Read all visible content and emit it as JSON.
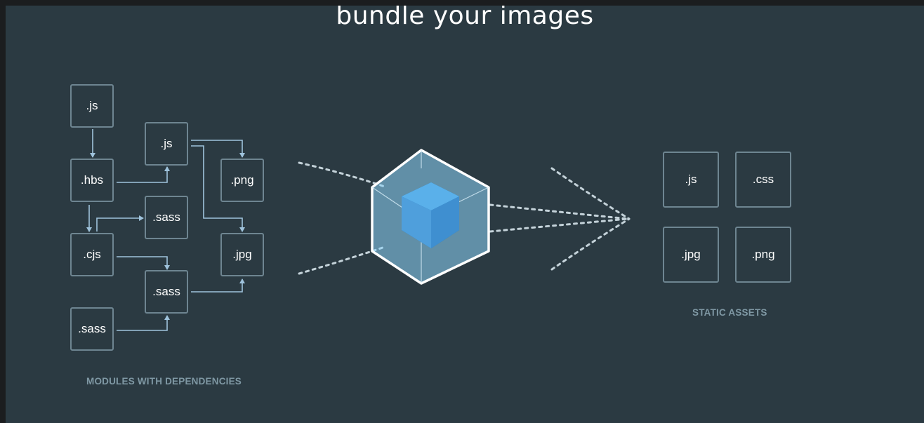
{
  "headline": "bundle your images",
  "modules": {
    "caption": "MODULES WITH DEPENDENCIES",
    "items": [
      ".js",
      ".hbs",
      ".cjs",
      ".sass",
      ".js",
      ".sass",
      ".sass",
      ".png",
      ".jpg"
    ]
  },
  "assets": {
    "caption": "STATIC ASSETS",
    "items": [
      ".js",
      ".css",
      ".jpg",
      ".png"
    ]
  },
  "colors": {
    "background": "#2b3a42",
    "box_border": "#6e8591",
    "arrow": "#9fc3dc",
    "cube_outer": "#8ed6fb",
    "cube_inner": "#1c78c0"
  }
}
